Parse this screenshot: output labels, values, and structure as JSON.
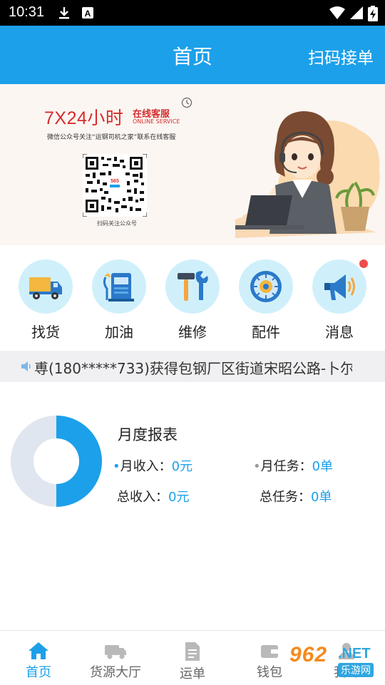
{
  "status_bar": {
    "time": "10:31",
    "icons": [
      "download-icon",
      "notification-a-icon",
      "wifi-icon",
      "signal-icon",
      "battery-charging-icon"
    ]
  },
  "app_bar": {
    "title": "首页",
    "action": "扫码接单",
    "color": "#1ca0ea"
  },
  "banner": {
    "headline": "7X24小时",
    "headline_tag": "在线客服",
    "headline_tag_en": "ONLINE SERVICE",
    "follow_text": "微信公众号关注“运钢司机之家”联系在线客服",
    "qr_caption": "扫码关注公众号"
  },
  "quick_menu": [
    {
      "label": "找货",
      "icon": "truck-icon"
    },
    {
      "label": "加油",
      "icon": "fuel-pump-icon"
    },
    {
      "label": "维修",
      "icon": "hammer-wrench-icon"
    },
    {
      "label": "配件",
      "icon": "gear-part-icon"
    },
    {
      "label": "消息",
      "icon": "megaphone-icon",
      "badge": true
    }
  ],
  "ticker": {
    "text": "尃(180*****733)获得包钢厂区街道宋昭公路-卜尔"
  },
  "report": {
    "title": "月度报表",
    "monthly_income_label": "月收入：",
    "monthly_income_value": "0元",
    "monthly_tasks_label": "月任务：",
    "monthly_tasks_value": "0单",
    "total_income_label": "总收入：",
    "total_income_value": "0元",
    "total_tasks_label": "总任务：",
    "total_tasks_value": "0单",
    "donut_fraction_highlighted": 0.5
  },
  "tab_bar": [
    {
      "label": "首页",
      "icon": "home-icon",
      "active": true
    },
    {
      "label": "货源大厅",
      "icon": "truck-icon",
      "active": false
    },
    {
      "label": "运单",
      "icon": "document-icon",
      "active": false
    },
    {
      "label": "钱包",
      "icon": "wallet-icon",
      "active": false
    },
    {
      "label": "我的",
      "icon": "person-icon",
      "active": false
    }
  ],
  "watermark": {
    "number": "962",
    "domain": ".NET",
    "name": "乐游网"
  }
}
